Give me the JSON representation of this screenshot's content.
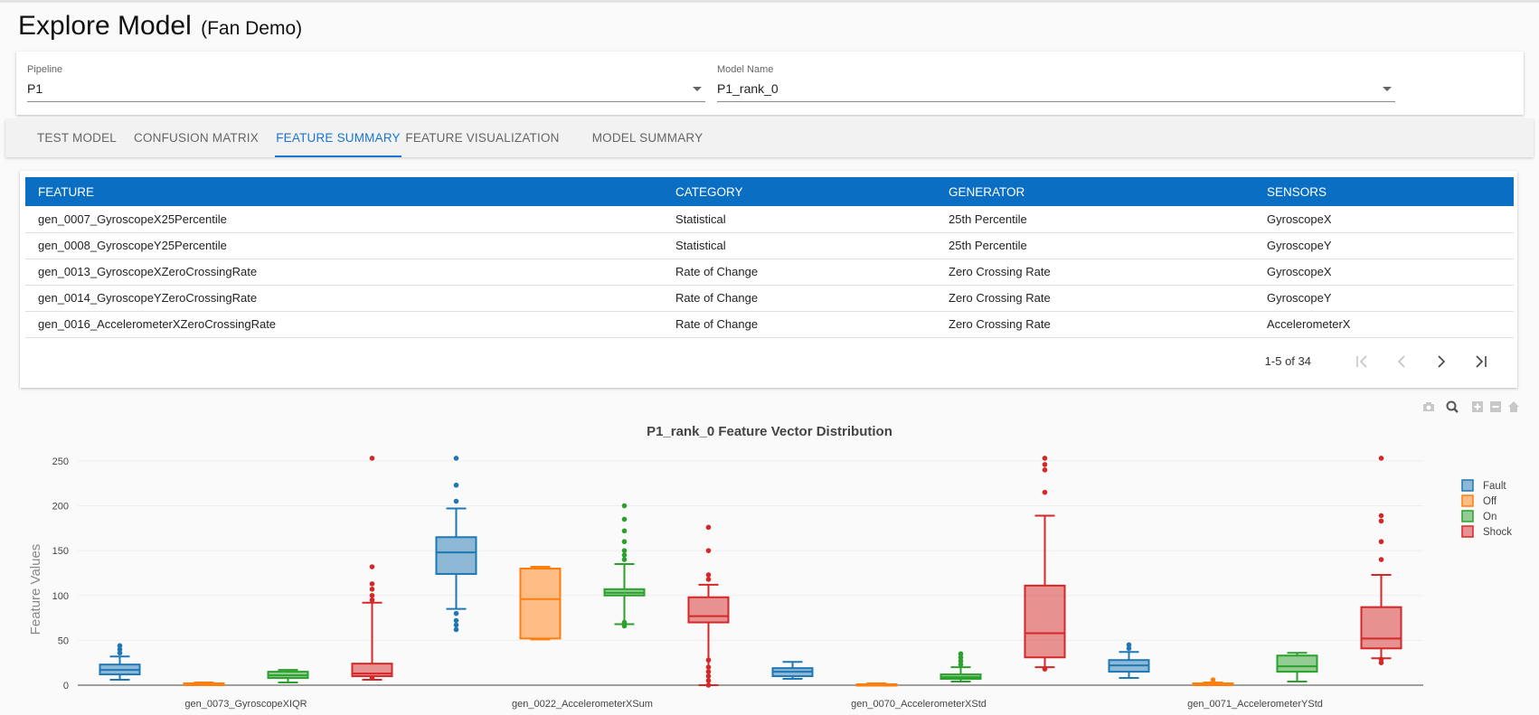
{
  "header": {
    "title": "Explore Model",
    "subtitle": "(Fan Demo)"
  },
  "selects": {
    "pipeline": {
      "label": "Pipeline",
      "value": "P1"
    },
    "model": {
      "label": "Model Name",
      "value": "P1_rank_0"
    }
  },
  "tabs": [
    {
      "label": "TEST MODEL",
      "active": false
    },
    {
      "label": "CONFUSION MATRIX",
      "active": false
    },
    {
      "label": "FEATURE SUMMARY",
      "active": true
    },
    {
      "label": "FEATURE VISUALIZATION",
      "active": false
    },
    {
      "label": "MODEL SUMMARY",
      "active": false
    }
  ],
  "table": {
    "columns": [
      "FEATURE",
      "CATEGORY",
      "GENERATOR",
      "SENSORS"
    ],
    "rows": [
      [
        "gen_0007_GyroscopeX25Percentile",
        "Statistical",
        "25th Percentile",
        "GyroscopeX"
      ],
      [
        "gen_0008_GyroscopeY25Percentile",
        "Statistical",
        "25th Percentile",
        "GyroscopeY"
      ],
      [
        "gen_0013_GyroscopeXZeroCrossingRate",
        "Rate of Change",
        "Zero Crossing Rate",
        "GyroscopeX"
      ],
      [
        "gen_0014_GyroscopeYZeroCrossingRate",
        "Rate of Change",
        "Zero Crossing Rate",
        "GyroscopeY"
      ],
      [
        "gen_0016_AccelerometerXZeroCrossingRate",
        "Rate of Change",
        "Zero Crossing Rate",
        "AccelerometerX"
      ]
    ],
    "pagination": "1-5 of 34"
  },
  "toolbar": {
    "icons": [
      "camera-icon",
      "zoom-icon",
      "zoom-in-icon",
      "zoom-out-icon",
      "home-icon"
    ]
  },
  "colors": {
    "accent": "#1976d2",
    "header": "#0a6fc2"
  },
  "chart_data": {
    "type": "box",
    "title": "P1_rank_0 Feature Vector Distribution",
    "ylabel": "Feature Values",
    "xlabel": "",
    "ylim": [
      0,
      250
    ],
    "yticks": [
      0,
      50,
      100,
      150,
      200,
      250
    ],
    "grid": true,
    "legend_position": "top-right",
    "categories": [
      "gen_0073_GyroscopeXIQR",
      "gen_0022_AccelerometerXSum",
      "gen_0070_AccelerometerXStd",
      "gen_0071_AccelerometerYStd"
    ],
    "series": [
      {
        "name": "Fault",
        "color": "#1f77b4",
        "boxes": [
          {
            "min": 6,
            "q1": 12,
            "median": 17,
            "q3": 23,
            "max": 32,
            "outliers": [
              36,
              40,
              44
            ]
          },
          {
            "min": 85,
            "q1": 124,
            "median": 148,
            "q3": 165,
            "max": 197,
            "outliers": [
              62,
              67,
              72,
              80,
              205,
              223,
              253
            ]
          },
          {
            "min": 7,
            "q1": 10,
            "median": 15,
            "q3": 19,
            "max": 26,
            "outliers": []
          },
          {
            "min": 8,
            "q1": 15,
            "median": 22,
            "q3": 28,
            "max": 37,
            "outliers": [
              41,
              45
            ]
          }
        ]
      },
      {
        "name": "Off",
        "color": "#ff7f0e",
        "boxes": [
          {
            "min": 0,
            "q1": 0,
            "median": 1,
            "q3": 2,
            "max": 3,
            "outliers": []
          },
          {
            "min": 51,
            "q1": 52,
            "median": 96,
            "q3": 130,
            "max": 132,
            "outliers": []
          },
          {
            "min": 0,
            "q1": 0,
            "median": 1,
            "q3": 1,
            "max": 2,
            "outliers": []
          },
          {
            "min": 0,
            "q1": 0,
            "median": 1,
            "q3": 2,
            "max": 3,
            "outliers": [
              6
            ]
          }
        ]
      },
      {
        "name": "On",
        "color": "#2ca02c",
        "boxes": [
          {
            "min": 3,
            "q1": 8,
            "median": 11,
            "q3": 15,
            "max": 17,
            "outliers": []
          },
          {
            "min": 68,
            "q1": 100,
            "median": 103,
            "q3": 107,
            "max": 135,
            "outliers": [
              66,
              70,
              140,
              145,
              150,
              160,
              172,
              185,
              200
            ]
          },
          {
            "min": 4,
            "q1": 7,
            "median": 9,
            "q3": 12,
            "max": 20,
            "outliers": [
              23,
              27,
              31,
              35
            ]
          },
          {
            "min": 4,
            "q1": 15,
            "median": 21,
            "q3": 33,
            "max": 36,
            "outliers": []
          }
        ]
      },
      {
        "name": "Shock",
        "color": "#d62728",
        "boxes": [
          {
            "min": 6,
            "q1": 10,
            "median": 13,
            "q3": 24,
            "max": 92,
            "outliers": [
              8,
              95,
              100,
              107,
              113,
              132,
              253
            ]
          },
          {
            "min": 0,
            "q1": 70,
            "median": 77,
            "q3": 98,
            "max": 112,
            "outliers": [
              0,
              5,
              10,
              15,
              20,
              28,
              118,
              123,
              150,
              176
            ]
          },
          {
            "min": 20,
            "q1": 31,
            "median": 58,
            "q3": 111,
            "max": 189,
            "outliers": [
              18,
              215,
              240,
              246,
              253
            ]
          },
          {
            "min": 30,
            "q1": 41,
            "median": 52,
            "q3": 87,
            "max": 123,
            "outliers": [
              25,
              29,
              140,
              160,
              183,
              189,
              253
            ]
          }
        ]
      }
    ]
  }
}
